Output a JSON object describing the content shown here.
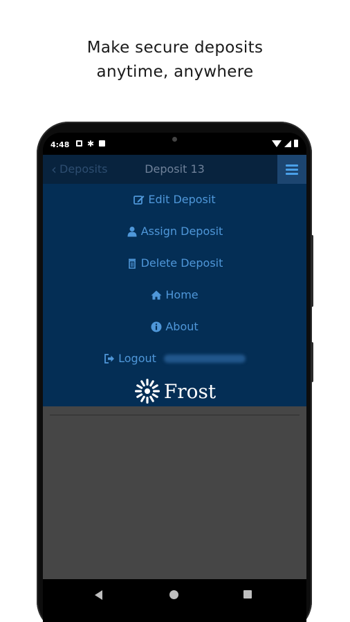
{
  "promo": {
    "line1": "Make secure deposits",
    "line2": "anytime, anywhere"
  },
  "status_bar": {
    "time": "4:48"
  },
  "header": {
    "back_label": "Deposits",
    "title": "Deposit 13"
  },
  "menu": {
    "items": [
      {
        "label": "Edit Deposit",
        "icon": "edit-icon"
      },
      {
        "label": "Assign Deposit",
        "icon": "user-icon"
      },
      {
        "label": "Delete Deposit",
        "icon": "trash-icon"
      },
      {
        "label": "Home",
        "icon": "home-icon"
      },
      {
        "label": "About",
        "icon": "info-icon"
      },
      {
        "label": "Logout",
        "icon": "logout-icon"
      }
    ]
  },
  "brand": {
    "name": "Frost"
  },
  "colors": {
    "menu_bg": "#042e55",
    "menu_text": "#4f97d9",
    "content_bg": "#464646",
    "accent": "#4aa0e8"
  }
}
